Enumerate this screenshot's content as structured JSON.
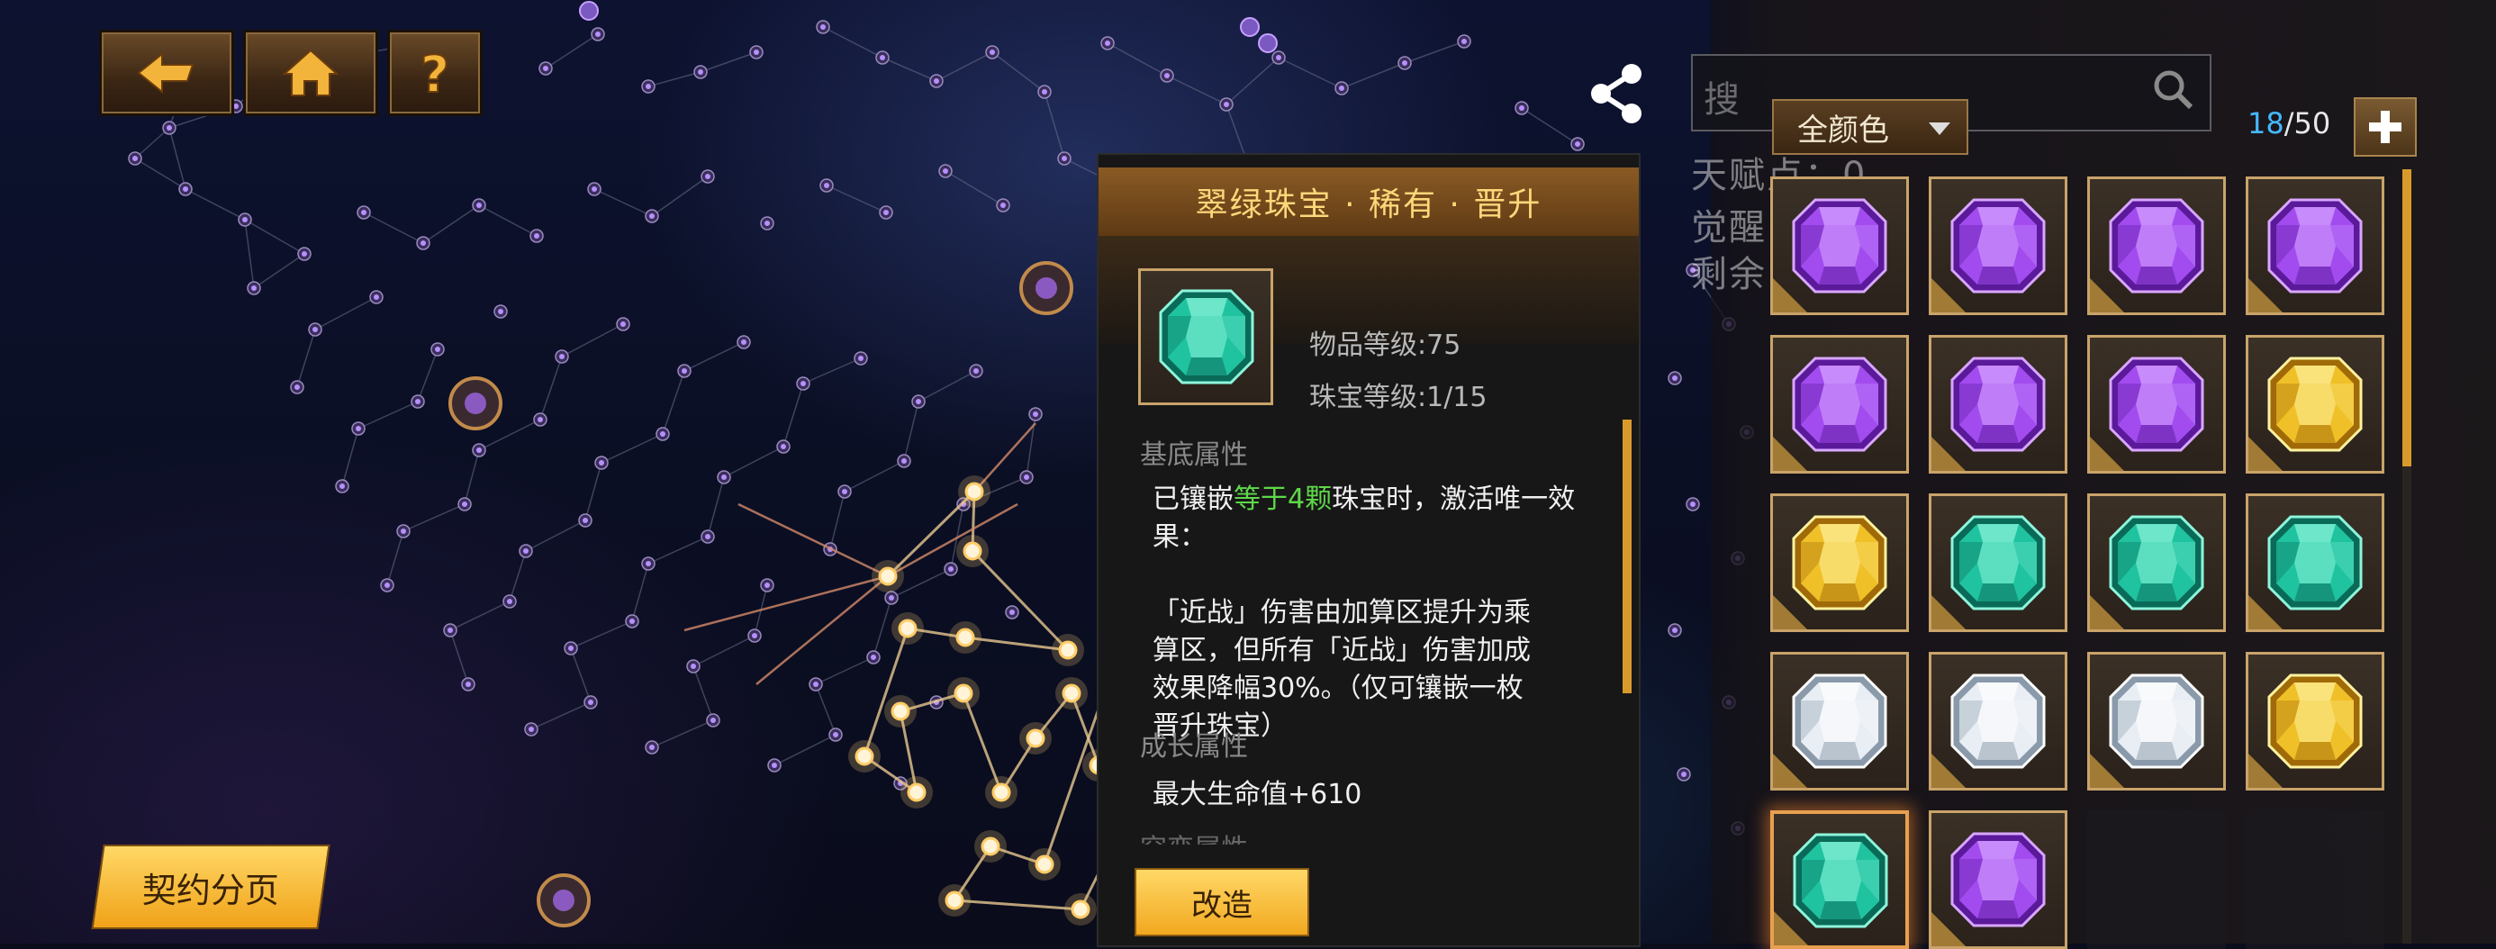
{
  "nav": {
    "back_icon": "back-arrow-icon",
    "home_icon": "home-icon",
    "help_icon": "question-mark-icon"
  },
  "share_icon": "share-icon",
  "search": {
    "placeholder": "搜"
  },
  "ghost_labels": [
    "天赋点：0",
    "觉醒",
    "剩余"
  ],
  "filter": {
    "label": "全颜色"
  },
  "inventory": {
    "count_current": "18",
    "count_max": "/50",
    "slots": [
      {
        "gem": "purple"
      },
      {
        "gem": "purple"
      },
      {
        "gem": "purple"
      },
      {
        "gem": "purple"
      },
      {
        "gem": "purple"
      },
      {
        "gem": "purple"
      },
      {
        "gem": "purple"
      },
      {
        "gem": "yellow"
      },
      {
        "gem": "yellow"
      },
      {
        "gem": "green"
      },
      {
        "gem": "green"
      },
      {
        "gem": "green"
      },
      {
        "gem": "white"
      },
      {
        "gem": "white"
      },
      {
        "gem": "white"
      },
      {
        "gem": "yellow"
      },
      {
        "gem": "green",
        "selected": true
      },
      {
        "gem": "purple"
      },
      {
        "gem": ""
      },
      {
        "gem": ""
      }
    ]
  },
  "tooltip": {
    "title": "翠绿珠宝 · 稀有 · 晋升",
    "item_level": "物品等级:75",
    "gem_level": "珠宝等级:1/15",
    "base_section": "基底属性",
    "desc_pre": "已镶嵌",
    "desc_hl": "等于4颗",
    "desc_post": "珠宝时，激活唯一效果：",
    "desc_lines": [
      "「近战」伤害由加算区提升为乘",
      "算区，但所有「近战」伤害加成",
      "效果降幅30%。（仅可镶嵌一枚",
      "晋升珠宝）"
    ],
    "growth_section": "成长属性",
    "growth_value": "最大生命值+610",
    "next_section": "突变属性",
    "modify_label": "改造"
  },
  "pact_button": {
    "label": "契约分页"
  },
  "colors": {
    "accent_gold": "#f2a820",
    "gem_purple": "#a24cf0",
    "gem_green": "#20c3a0",
    "gem_yellow": "#f0c028",
    "gem_white": "#e8eef4",
    "highlight_green": "#5fd84a",
    "count_blue": "#45b8ff"
  }
}
